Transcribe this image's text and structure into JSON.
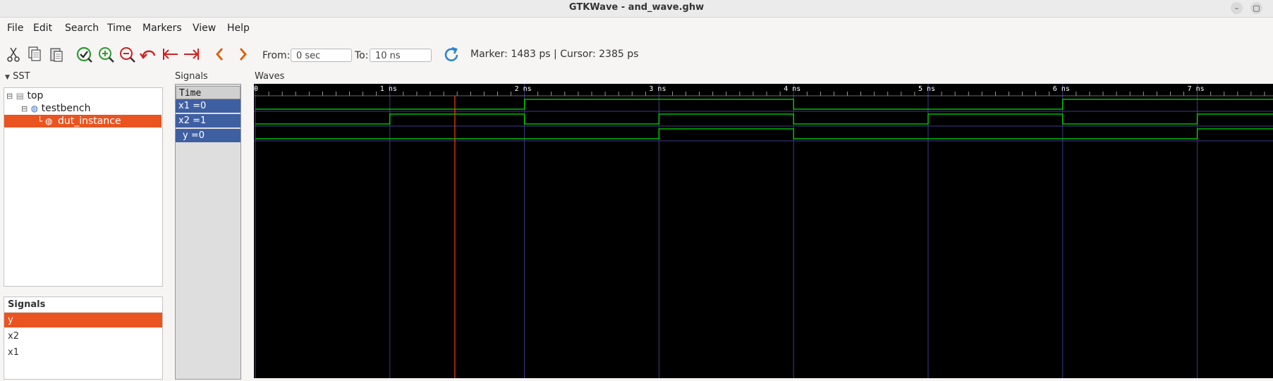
{
  "window": {
    "title": "GTKWave - and_wave.ghw"
  },
  "menu": [
    "File",
    "Edit",
    "Search",
    "Time",
    "Markers",
    "View",
    "Help"
  ],
  "toolbar": {
    "from_label": "From:",
    "from_value": "0 sec",
    "to_label": "To:",
    "to_value": "10 ns",
    "status": "Marker: 1483 ps  |  Cursor: 2385 ps"
  },
  "sst": {
    "label": "SST",
    "tree": [
      {
        "label": "top"
      },
      {
        "label": "testbench"
      },
      {
        "label": "dut_instance",
        "selected": true
      }
    ]
  },
  "signals_list": {
    "header": "Signals",
    "items": [
      {
        "label": "y",
        "selected": true
      },
      {
        "label": "x2"
      },
      {
        "label": "x1"
      }
    ]
  },
  "signals_pane": {
    "label": "Signals",
    "time_header": "Time",
    "rows": [
      "x1 =0",
      "x2 =1",
      "y =0"
    ]
  },
  "waves": {
    "label": "Waves",
    "ticks": [
      "0",
      "1 ns",
      "2 ns",
      "3 ns",
      "4 ns",
      "5 ns",
      "6 ns",
      "7 ns"
    ],
    "marker_ps": 1483,
    "time_per_division_ps": 1000,
    "signals": [
      {
        "name": "x1",
        "changes_ns": [
          [
            0,
            0
          ],
          [
            2,
            1
          ],
          [
            4,
            0
          ],
          [
            6,
            1
          ]
        ]
      },
      {
        "name": "x2",
        "changes_ns": [
          [
            0,
            0
          ],
          [
            1,
            1
          ],
          [
            2,
            0
          ],
          [
            3,
            1
          ],
          [
            4,
            0
          ],
          [
            5,
            1
          ],
          [
            6,
            0
          ],
          [
            7,
            1
          ]
        ]
      },
      {
        "name": "y",
        "changes_ns": [
          [
            0,
            0
          ],
          [
            3,
            1
          ],
          [
            4,
            0
          ],
          [
            7,
            1
          ]
        ]
      }
    ],
    "colors": {
      "wave": "#00e000",
      "grid": "#3d3d8a",
      "marker": "#ff3b1e",
      "tick_text": "#ffffff"
    }
  },
  "colors": {
    "selection": "#e95420",
    "signal_row": "#3f5fa3",
    "refresh": "#2a84d1",
    "zoom": "#2e9a2e",
    "nav_arrow": "#e05a00",
    "undo": "#d12020"
  }
}
